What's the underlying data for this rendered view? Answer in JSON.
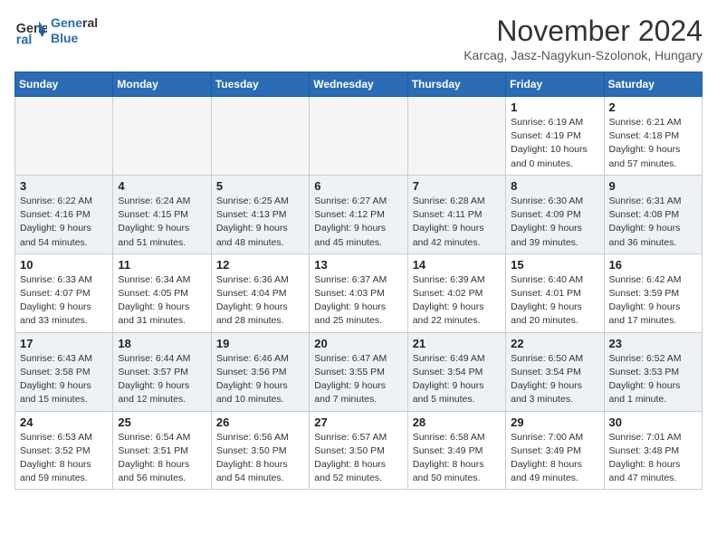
{
  "header": {
    "logo_line1": "General",
    "logo_line2": "Blue",
    "month_title": "November 2024",
    "location": "Karcag, Jasz-Nagykun-Szolonok, Hungary"
  },
  "weekdays": [
    "Sunday",
    "Monday",
    "Tuesday",
    "Wednesday",
    "Thursday",
    "Friday",
    "Saturday"
  ],
  "weeks": [
    [
      {
        "day": "",
        "info": ""
      },
      {
        "day": "",
        "info": ""
      },
      {
        "day": "",
        "info": ""
      },
      {
        "day": "",
        "info": ""
      },
      {
        "day": "",
        "info": ""
      },
      {
        "day": "1",
        "info": "Sunrise: 6:19 AM\nSunset: 4:19 PM\nDaylight: 10 hours\nand 0 minutes."
      },
      {
        "day": "2",
        "info": "Sunrise: 6:21 AM\nSunset: 4:18 PM\nDaylight: 9 hours\nand 57 minutes."
      }
    ],
    [
      {
        "day": "3",
        "info": "Sunrise: 6:22 AM\nSunset: 4:16 PM\nDaylight: 9 hours\nand 54 minutes."
      },
      {
        "day": "4",
        "info": "Sunrise: 6:24 AM\nSunset: 4:15 PM\nDaylight: 9 hours\nand 51 minutes."
      },
      {
        "day": "5",
        "info": "Sunrise: 6:25 AM\nSunset: 4:13 PM\nDaylight: 9 hours\nand 48 minutes."
      },
      {
        "day": "6",
        "info": "Sunrise: 6:27 AM\nSunset: 4:12 PM\nDaylight: 9 hours\nand 45 minutes."
      },
      {
        "day": "7",
        "info": "Sunrise: 6:28 AM\nSunset: 4:11 PM\nDaylight: 9 hours\nand 42 minutes."
      },
      {
        "day": "8",
        "info": "Sunrise: 6:30 AM\nSunset: 4:09 PM\nDaylight: 9 hours\nand 39 minutes."
      },
      {
        "day": "9",
        "info": "Sunrise: 6:31 AM\nSunset: 4:08 PM\nDaylight: 9 hours\nand 36 minutes."
      }
    ],
    [
      {
        "day": "10",
        "info": "Sunrise: 6:33 AM\nSunset: 4:07 PM\nDaylight: 9 hours\nand 33 minutes."
      },
      {
        "day": "11",
        "info": "Sunrise: 6:34 AM\nSunset: 4:05 PM\nDaylight: 9 hours\nand 31 minutes."
      },
      {
        "day": "12",
        "info": "Sunrise: 6:36 AM\nSunset: 4:04 PM\nDaylight: 9 hours\nand 28 minutes."
      },
      {
        "day": "13",
        "info": "Sunrise: 6:37 AM\nSunset: 4:03 PM\nDaylight: 9 hours\nand 25 minutes."
      },
      {
        "day": "14",
        "info": "Sunrise: 6:39 AM\nSunset: 4:02 PM\nDaylight: 9 hours\nand 22 minutes."
      },
      {
        "day": "15",
        "info": "Sunrise: 6:40 AM\nSunset: 4:01 PM\nDaylight: 9 hours\nand 20 minutes."
      },
      {
        "day": "16",
        "info": "Sunrise: 6:42 AM\nSunset: 3:59 PM\nDaylight: 9 hours\nand 17 minutes."
      }
    ],
    [
      {
        "day": "17",
        "info": "Sunrise: 6:43 AM\nSunset: 3:58 PM\nDaylight: 9 hours\nand 15 minutes."
      },
      {
        "day": "18",
        "info": "Sunrise: 6:44 AM\nSunset: 3:57 PM\nDaylight: 9 hours\nand 12 minutes."
      },
      {
        "day": "19",
        "info": "Sunrise: 6:46 AM\nSunset: 3:56 PM\nDaylight: 9 hours\nand 10 minutes."
      },
      {
        "day": "20",
        "info": "Sunrise: 6:47 AM\nSunset: 3:55 PM\nDaylight: 9 hours\nand 7 minutes."
      },
      {
        "day": "21",
        "info": "Sunrise: 6:49 AM\nSunset: 3:54 PM\nDaylight: 9 hours\nand 5 minutes."
      },
      {
        "day": "22",
        "info": "Sunrise: 6:50 AM\nSunset: 3:54 PM\nDaylight: 9 hours\nand 3 minutes."
      },
      {
        "day": "23",
        "info": "Sunrise: 6:52 AM\nSunset: 3:53 PM\nDaylight: 9 hours\nand 1 minute."
      }
    ],
    [
      {
        "day": "24",
        "info": "Sunrise: 6:53 AM\nSunset: 3:52 PM\nDaylight: 8 hours\nand 59 minutes."
      },
      {
        "day": "25",
        "info": "Sunrise: 6:54 AM\nSunset: 3:51 PM\nDaylight: 8 hours\nand 56 minutes."
      },
      {
        "day": "26",
        "info": "Sunrise: 6:56 AM\nSunset: 3:50 PM\nDaylight: 8 hours\nand 54 minutes."
      },
      {
        "day": "27",
        "info": "Sunrise: 6:57 AM\nSunset: 3:50 PM\nDaylight: 8 hours\nand 52 minutes."
      },
      {
        "day": "28",
        "info": "Sunrise: 6:58 AM\nSunset: 3:49 PM\nDaylight: 8 hours\nand 50 minutes."
      },
      {
        "day": "29",
        "info": "Sunrise: 7:00 AM\nSunset: 3:49 PM\nDaylight: 8 hours\nand 49 minutes."
      },
      {
        "day": "30",
        "info": "Sunrise: 7:01 AM\nSunset: 3:48 PM\nDaylight: 8 hours\nand 47 minutes."
      }
    ]
  ]
}
